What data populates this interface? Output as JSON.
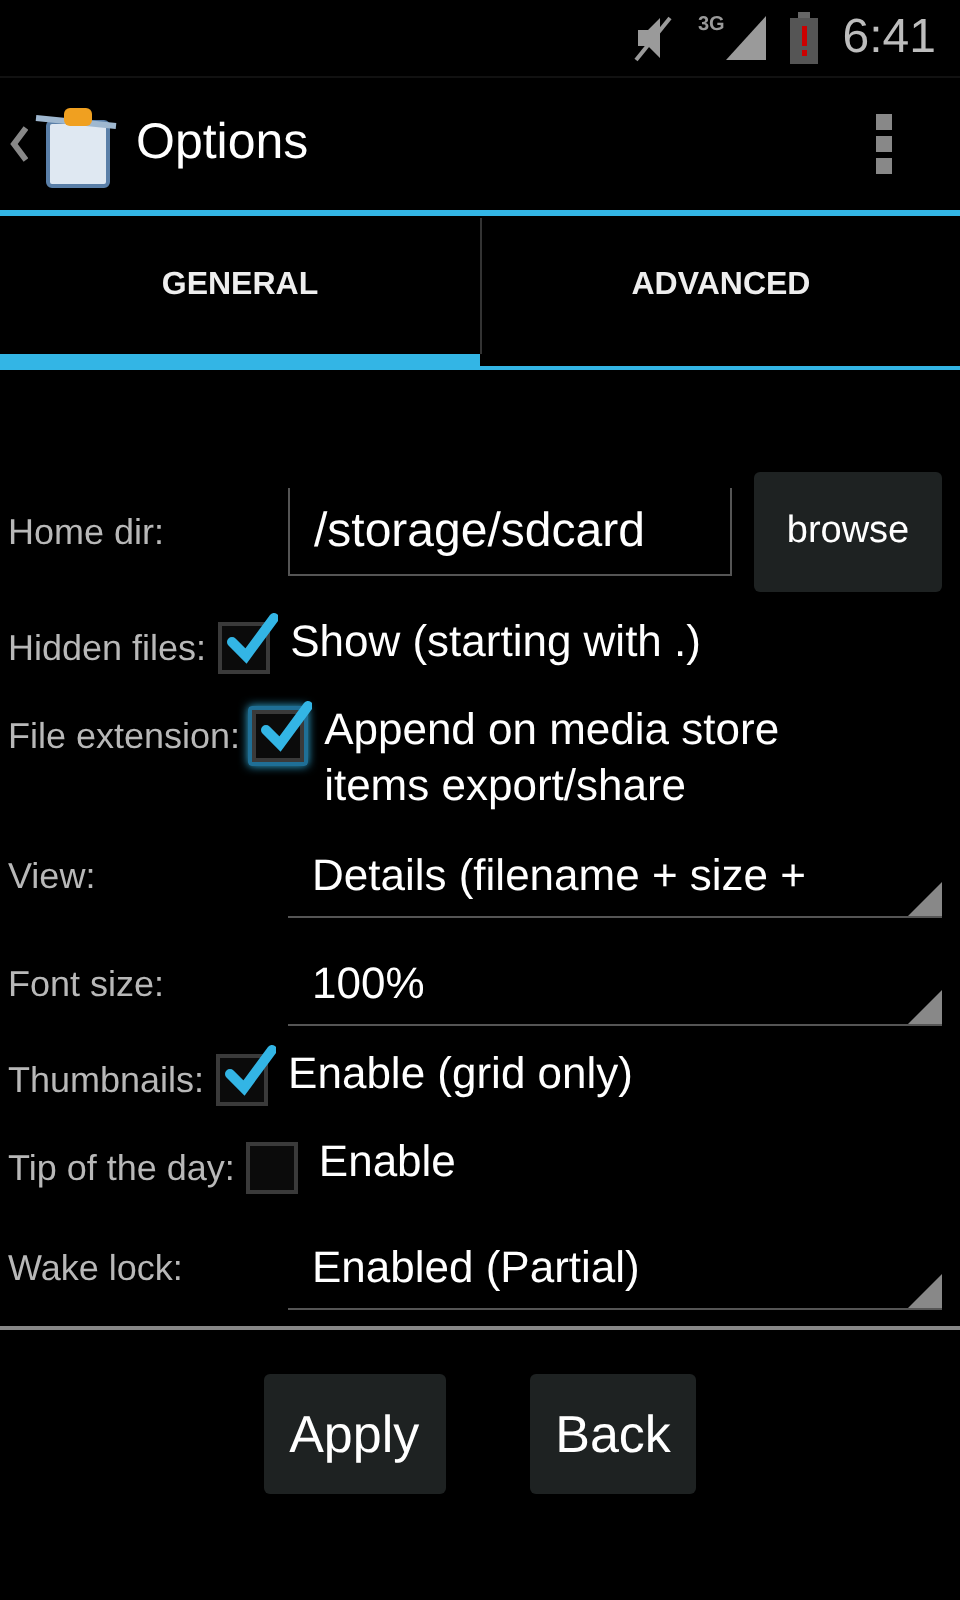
{
  "status_bar": {
    "time": "6:41",
    "network": "3G"
  },
  "action_bar": {
    "title": "Options"
  },
  "tabs": [
    {
      "label": "GENERAL",
      "selected": true
    },
    {
      "label": "ADVANCED",
      "selected": false
    }
  ],
  "settings": [
    {
      "kind": "path",
      "label": "Home dir:",
      "value": "/storage/sdcard",
      "button": "browse"
    },
    {
      "kind": "checkbox",
      "label": "Hidden files:",
      "text": "Show (starting with .)",
      "checked": true,
      "focused": false
    },
    {
      "kind": "checkbox",
      "label": "File extension:",
      "text": "Append on media store items export/share",
      "checked": true,
      "focused": true
    },
    {
      "kind": "spinner",
      "label": "View:",
      "value": "Details (filename + size +"
    },
    {
      "kind": "spinner",
      "label": "Font size:",
      "value": "100%"
    },
    {
      "kind": "checkbox",
      "label": "Thumbnails:",
      "text": "Enable (grid only)",
      "checked": true,
      "focused": false
    },
    {
      "kind": "checkbox",
      "label": "Tip of the day:",
      "text": "Enable",
      "checked": false,
      "focused": false
    },
    {
      "kind": "spinner",
      "label": "Wake lock:",
      "value": "Enabled (Partial)"
    }
  ],
  "buttons": [
    "Apply",
    "Back"
  ]
}
